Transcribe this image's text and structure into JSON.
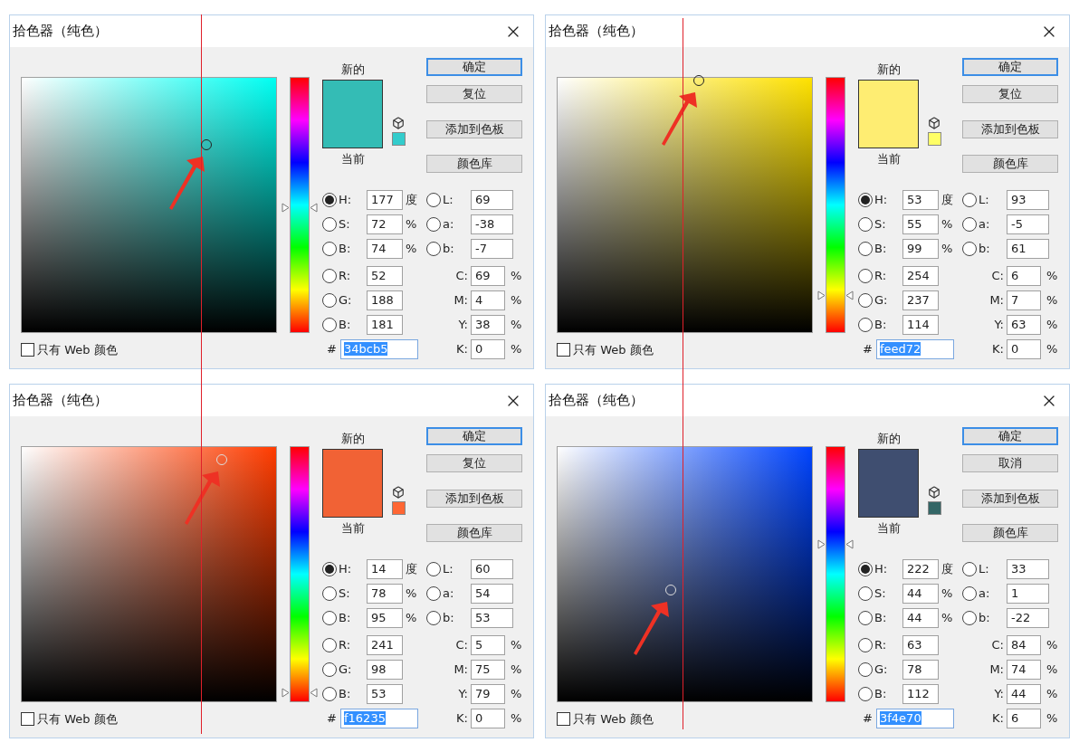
{
  "dialogs": [
    {
      "title": "拾色器（纯色）",
      "color_field": {
        "color": "#00fff2"
      },
      "hue_slider": {
        "level": 0.49
      },
      "buttons": [
        {
          "label": "确定",
          "default": true
        },
        {
          "label": "复位",
          "default": false
        },
        {
          "label": "添加到色板",
          "default": false
        },
        {
          "label": "颜色库",
          "default": false
        }
      ],
      "new_swatch": {
        "label": "新的",
        "color": "#34bcb5"
      },
      "current_swatch": {
        "label": "当前",
        "color": "#34bcb5"
      },
      "web_swatch": {
        "color": "#33cccc"
      },
      "hsb": [
        {
          "label": "H:",
          "value": "177",
          "unit": "度",
          "selected": true
        },
        {
          "label": "S:",
          "value": "72",
          "unit": "%",
          "selected": false
        },
        {
          "label": "B:",
          "value": "74",
          "unit": "%",
          "selected": false
        }
      ],
      "lab": [
        {
          "label": "L:",
          "value": "69",
          "selected": false
        },
        {
          "label": "a:",
          "value": "-38",
          "selected": false
        },
        {
          "label": "b:",
          "value": "-7",
          "selected": false
        }
      ],
      "rgb": [
        {
          "label": "R:",
          "value": "52",
          "selected": false
        },
        {
          "label": "G:",
          "value": "188",
          "selected": false
        },
        {
          "label": "B:",
          "value": "181",
          "selected": false
        }
      ],
      "cmyk": [
        {
          "label": "C:",
          "value": "69",
          "unit": "%"
        },
        {
          "label": "M:",
          "value": "4",
          "unit": "%"
        },
        {
          "label": "Y:",
          "value": "38",
          "unit": "%"
        },
        {
          "label": "K:",
          "value": "0",
          "unit": "%"
        }
      ],
      "hex": {
        "label": "#",
        "value": "34bcb5",
        "selected": true
      },
      "web_only": {
        "label": "只有 Web 颜色",
        "checked": false
      }
    },
    {
      "title": "拾色器（纯色）",
      "color_field": {
        "color": "#ffe200"
      },
      "hue_slider": {
        "level": 0.15
      },
      "buttons": [
        {
          "label": "确定",
          "default": true
        },
        {
          "label": "复位",
          "default": false
        },
        {
          "label": "添加到色板",
          "default": false
        },
        {
          "label": "颜色库",
          "default": false
        }
      ],
      "new_swatch": {
        "label": "新的",
        "color": "#feed72"
      },
      "current_swatch": {
        "label": "当前",
        "color": "#feed72"
      },
      "web_swatch": {
        "color": "#ffff66"
      },
      "hsb": [
        {
          "label": "H:",
          "value": "53",
          "unit": "度",
          "selected": true
        },
        {
          "label": "S:",
          "value": "55",
          "unit": "%",
          "selected": false
        },
        {
          "label": "B:",
          "value": "99",
          "unit": "%",
          "selected": false
        }
      ],
      "lab": [
        {
          "label": "L:",
          "value": "93",
          "selected": false
        },
        {
          "label": "a:",
          "value": "-5",
          "selected": false
        },
        {
          "label": "b:",
          "value": "61",
          "selected": false
        }
      ],
      "rgb": [
        {
          "label": "R:",
          "value": "254",
          "selected": false
        },
        {
          "label": "G:",
          "value": "237",
          "selected": false
        },
        {
          "label": "B:",
          "value": "114",
          "selected": false
        }
      ],
      "cmyk": [
        {
          "label": "C:",
          "value": "6",
          "unit": "%"
        },
        {
          "label": "M:",
          "value": "7",
          "unit": "%"
        },
        {
          "label": "Y:",
          "value": "63",
          "unit": "%"
        },
        {
          "label": "K:",
          "value": "0",
          "unit": "%"
        }
      ],
      "hex": {
        "label": "#",
        "value": "feed72",
        "selected": true
      },
      "web_only": {
        "label": "只有 Web 颜色",
        "checked": false
      }
    },
    {
      "title": "拾色器（纯色）",
      "color_field": {
        "color": "#ff3c00"
      },
      "hue_slider": {
        "level": 0.04
      },
      "buttons": [
        {
          "label": "确定",
          "default": true
        },
        {
          "label": "复位",
          "default": false
        },
        {
          "label": "添加到色板",
          "default": false
        },
        {
          "label": "颜色库",
          "default": false
        }
      ],
      "new_swatch": {
        "label": "新的",
        "color": "#f16235"
      },
      "current_swatch": {
        "label": "当前",
        "color": "#f16235"
      },
      "web_swatch": {
        "color": "#ff6633"
      },
      "hsb": [
        {
          "label": "H:",
          "value": "14",
          "unit": "度",
          "selected": true
        },
        {
          "label": "S:",
          "value": "78",
          "unit": "%",
          "selected": false
        },
        {
          "label": "B:",
          "value": "95",
          "unit": "%",
          "selected": false
        }
      ],
      "lab": [
        {
          "label": "L:",
          "value": "60",
          "selected": false
        },
        {
          "label": "a:",
          "value": "54",
          "selected": false
        },
        {
          "label": "b:",
          "value": "53",
          "selected": false
        }
      ],
      "rgb": [
        {
          "label": "R:",
          "value": "241",
          "selected": false
        },
        {
          "label": "G:",
          "value": "98",
          "selected": false
        },
        {
          "label": "B:",
          "value": "53",
          "selected": false
        }
      ],
      "cmyk": [
        {
          "label": "C:",
          "value": "5",
          "unit": "%"
        },
        {
          "label": "M:",
          "value": "75",
          "unit": "%"
        },
        {
          "label": "Y:",
          "value": "79",
          "unit": "%"
        },
        {
          "label": "K:",
          "value": "0",
          "unit": "%"
        }
      ],
      "hex": {
        "label": "#",
        "value": "f16235",
        "selected": true
      },
      "web_only": {
        "label": "只有 Web 颜色",
        "checked": false
      }
    },
    {
      "title": "拾色器（纯色）",
      "color_field": {
        "color": "#0044ff"
      },
      "hue_slider": {
        "level": 0.62
      },
      "buttons": [
        {
          "label": "确定",
          "default": true
        },
        {
          "label": "取消",
          "default": false
        },
        {
          "label": "添加到色板",
          "default": false
        },
        {
          "label": "颜色库",
          "default": false
        }
      ],
      "new_swatch": {
        "label": "新的",
        "color": "#3f4e70"
      },
      "current_swatch": {
        "label": "当前",
        "color": "#3f4e70"
      },
      "web_swatch": {
        "color": "#336666"
      },
      "hsb": [
        {
          "label": "H:",
          "value": "222",
          "unit": "度",
          "selected": true
        },
        {
          "label": "S:",
          "value": "44",
          "unit": "%",
          "selected": false
        },
        {
          "label": "B:",
          "value": "44",
          "unit": "%",
          "selected": false
        }
      ],
      "lab": [
        {
          "label": "L:",
          "value": "33",
          "selected": false
        },
        {
          "label": "a:",
          "value": "1",
          "selected": false
        },
        {
          "label": "b:",
          "value": "-22",
          "selected": false
        }
      ],
      "rgb": [
        {
          "label": "R:",
          "value": "63",
          "selected": false
        },
        {
          "label": "G:",
          "value": "78",
          "selected": false
        },
        {
          "label": "B:",
          "value": "112",
          "selected": false
        }
      ],
      "cmyk": [
        {
          "label": "C:",
          "value": "84",
          "unit": "%"
        },
        {
          "label": "M:",
          "value": "74",
          "unit": "%"
        },
        {
          "label": "Y:",
          "value": "44",
          "unit": "%"
        },
        {
          "label": "K:",
          "value": "6",
          "unit": "%"
        }
      ],
      "hex": {
        "label": "#",
        "value": "3f4e70",
        "selected": true
      },
      "web_only": {
        "label": "只有 Web 颜色",
        "checked": false
      }
    }
  ]
}
